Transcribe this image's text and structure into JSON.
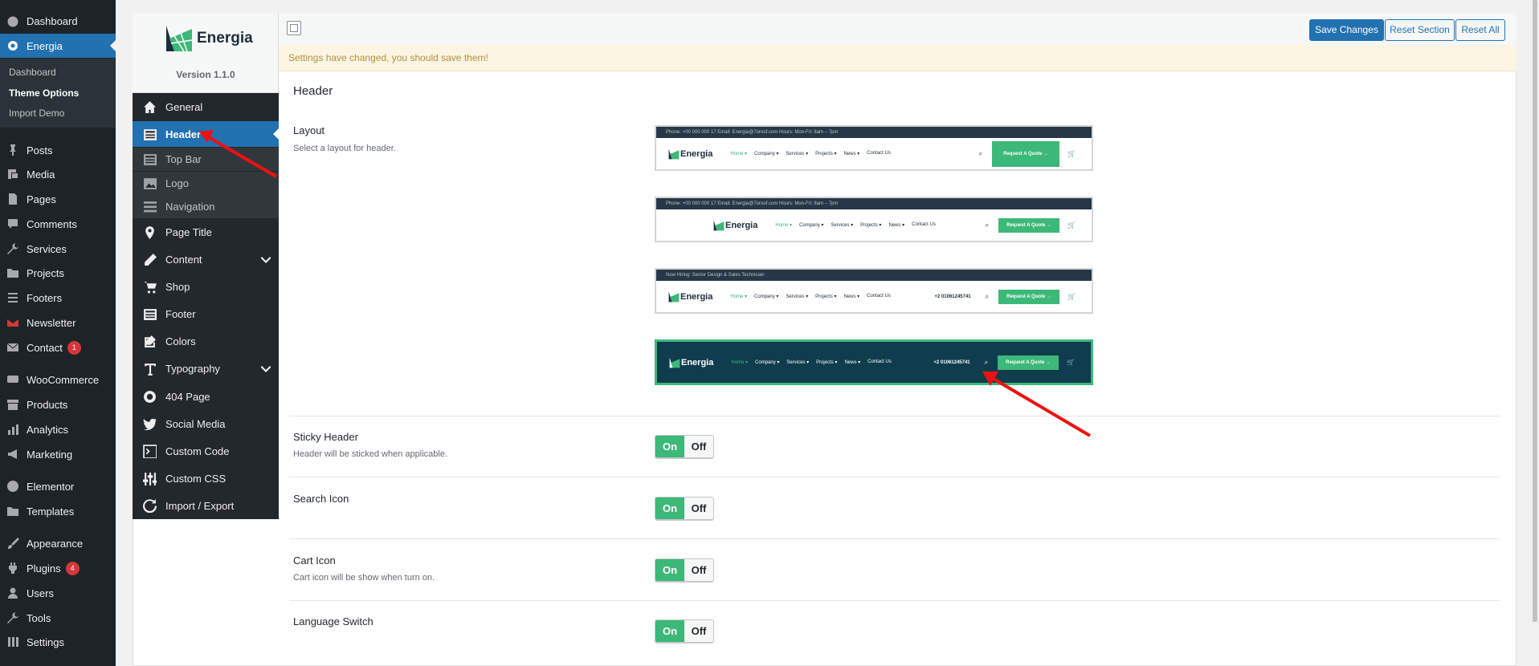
{
  "wp_menu": {
    "items": [
      {
        "label": "Dashboard",
        "icon": "dashboard-icon"
      },
      {
        "label": "Energia",
        "icon": "gear-icon"
      },
      {
        "label": "Posts",
        "icon": "pin-icon"
      },
      {
        "label": "Media",
        "icon": "media-icon"
      },
      {
        "label": "Pages",
        "icon": "page-icon"
      },
      {
        "label": "Comments",
        "icon": "comment-icon"
      },
      {
        "label": "Services",
        "icon": "wrench-icon"
      },
      {
        "label": "Projects",
        "icon": "folder-icon"
      },
      {
        "label": "Footers",
        "icon": "list-icon"
      },
      {
        "label": "Newsletter",
        "icon": "mail-icon"
      },
      {
        "label": "Contact",
        "icon": "envelope-icon",
        "badge": "1"
      },
      {
        "label": "WooCommerce",
        "icon": "woo-icon"
      },
      {
        "label": "Products",
        "icon": "archive-icon"
      },
      {
        "label": "Analytics",
        "icon": "chart-icon"
      },
      {
        "label": "Marketing",
        "icon": "megaphone-icon"
      },
      {
        "label": "Elementor",
        "icon": "elementor-icon"
      },
      {
        "label": "Templates",
        "icon": "folder-icon"
      },
      {
        "label": "Appearance",
        "icon": "brush-icon"
      },
      {
        "label": "Plugins",
        "icon": "plugin-icon",
        "badge": "4"
      },
      {
        "label": "Users",
        "icon": "user-icon"
      },
      {
        "label": "Tools",
        "icon": "wrench-icon"
      },
      {
        "label": "Settings",
        "icon": "settings-icon"
      }
    ],
    "energia_sub": [
      "Dashboard",
      "Theme Options",
      "Import Demo"
    ]
  },
  "brand": {
    "name": "Energia",
    "version": "Version 1.1.0"
  },
  "toolbar": {
    "save": "Save Changes",
    "reset_section": "Reset Section",
    "reset_all": "Reset All"
  },
  "notice": "Settings have changed, you should save them!",
  "options_menu": [
    {
      "label": "General",
      "icon": "home-icon"
    },
    {
      "label": "Header",
      "icon": "layout-icon"
    },
    {
      "label": "Top Bar",
      "icon": "layout-icon"
    },
    {
      "label": "Logo",
      "icon": "image-icon"
    },
    {
      "label": "Navigation",
      "icon": "menu-icon"
    },
    {
      "label": "Page Title",
      "icon": "location-icon"
    },
    {
      "label": "Content",
      "icon": "pencil-icon"
    },
    {
      "label": "Shop",
      "icon": "cart-icon"
    },
    {
      "label": "Footer",
      "icon": "layout-icon"
    },
    {
      "label": "Colors",
      "icon": "edit-icon"
    },
    {
      "label": "Typography",
      "icon": "text-icon"
    },
    {
      "label": "404 Page",
      "icon": "error-icon"
    },
    {
      "label": "Social Media",
      "icon": "twitter-icon"
    },
    {
      "label": "Custom Code",
      "icon": "code-icon"
    },
    {
      "label": "Custom CSS",
      "icon": "sliders-icon"
    },
    {
      "label": "Import / Export",
      "icon": "refresh-icon"
    }
  ],
  "section_title": "Header",
  "layout": {
    "label": "Layout",
    "desc": "Select a layout for header.",
    "selected_index": 3,
    "previews": [
      {
        "topbar": "Phone: +00 000 000 17    Email: Energia@7oroof.com    Hours: Mon-Fri: 8am – 7pm",
        "logo": "Energia",
        "nav": [
          "Home ▾",
          "Company ▾",
          "Services ▾",
          "Projects ▾",
          "News ▾",
          "Contact Us"
        ],
        "cta": "Request A Quote →"
      },
      {
        "topbar": "Phone: +00 000 000 17    Email: Energia@7oroof.com    Hours: Mon-Fri: 8am – 7pm",
        "logo": "Energia",
        "nav": [
          "Home ▾",
          "Company ▾",
          "Services ▾",
          "Projects ▾",
          "News ▾",
          "Contact Us"
        ],
        "cta": "Request A Quote →"
      },
      {
        "topbar": "Now Hiring: Senior Design & Sales Technician",
        "logo": "Energia",
        "nav": [
          "Home ▾",
          "Company ▾",
          "Services ▾",
          "Projects ▾",
          "News ▾",
          "Contact Us"
        ],
        "cta": "Request A Quote →",
        "phone": "+2 01061245741"
      },
      {
        "topbar": "",
        "logo": "Energia",
        "nav": [
          "Home ▾",
          "Company ▾",
          "Services ▾",
          "Projects ▾",
          "News ▾",
          "Contact Us"
        ],
        "cta": "Request A Quote →",
        "phone": "+2 01061245741"
      }
    ]
  },
  "toggles": [
    {
      "label": "Sticky Header",
      "desc": "Header will be sticked when applicable.",
      "on": "On",
      "off": "Off"
    },
    {
      "label": "Search Icon",
      "desc": "",
      "on": "On",
      "off": "Off"
    },
    {
      "label": "Cart Icon",
      "desc": "Cart icon will be show when turn on.",
      "on": "On",
      "off": "Off"
    },
    {
      "label": "Language Switch",
      "desc": "",
      "on": "On",
      "off": "Off"
    }
  ],
  "colors": {
    "accent": "#2271b1",
    "green": "#3cb878",
    "sidebar": "#1d2327",
    "notice": "#fcf5e3"
  }
}
